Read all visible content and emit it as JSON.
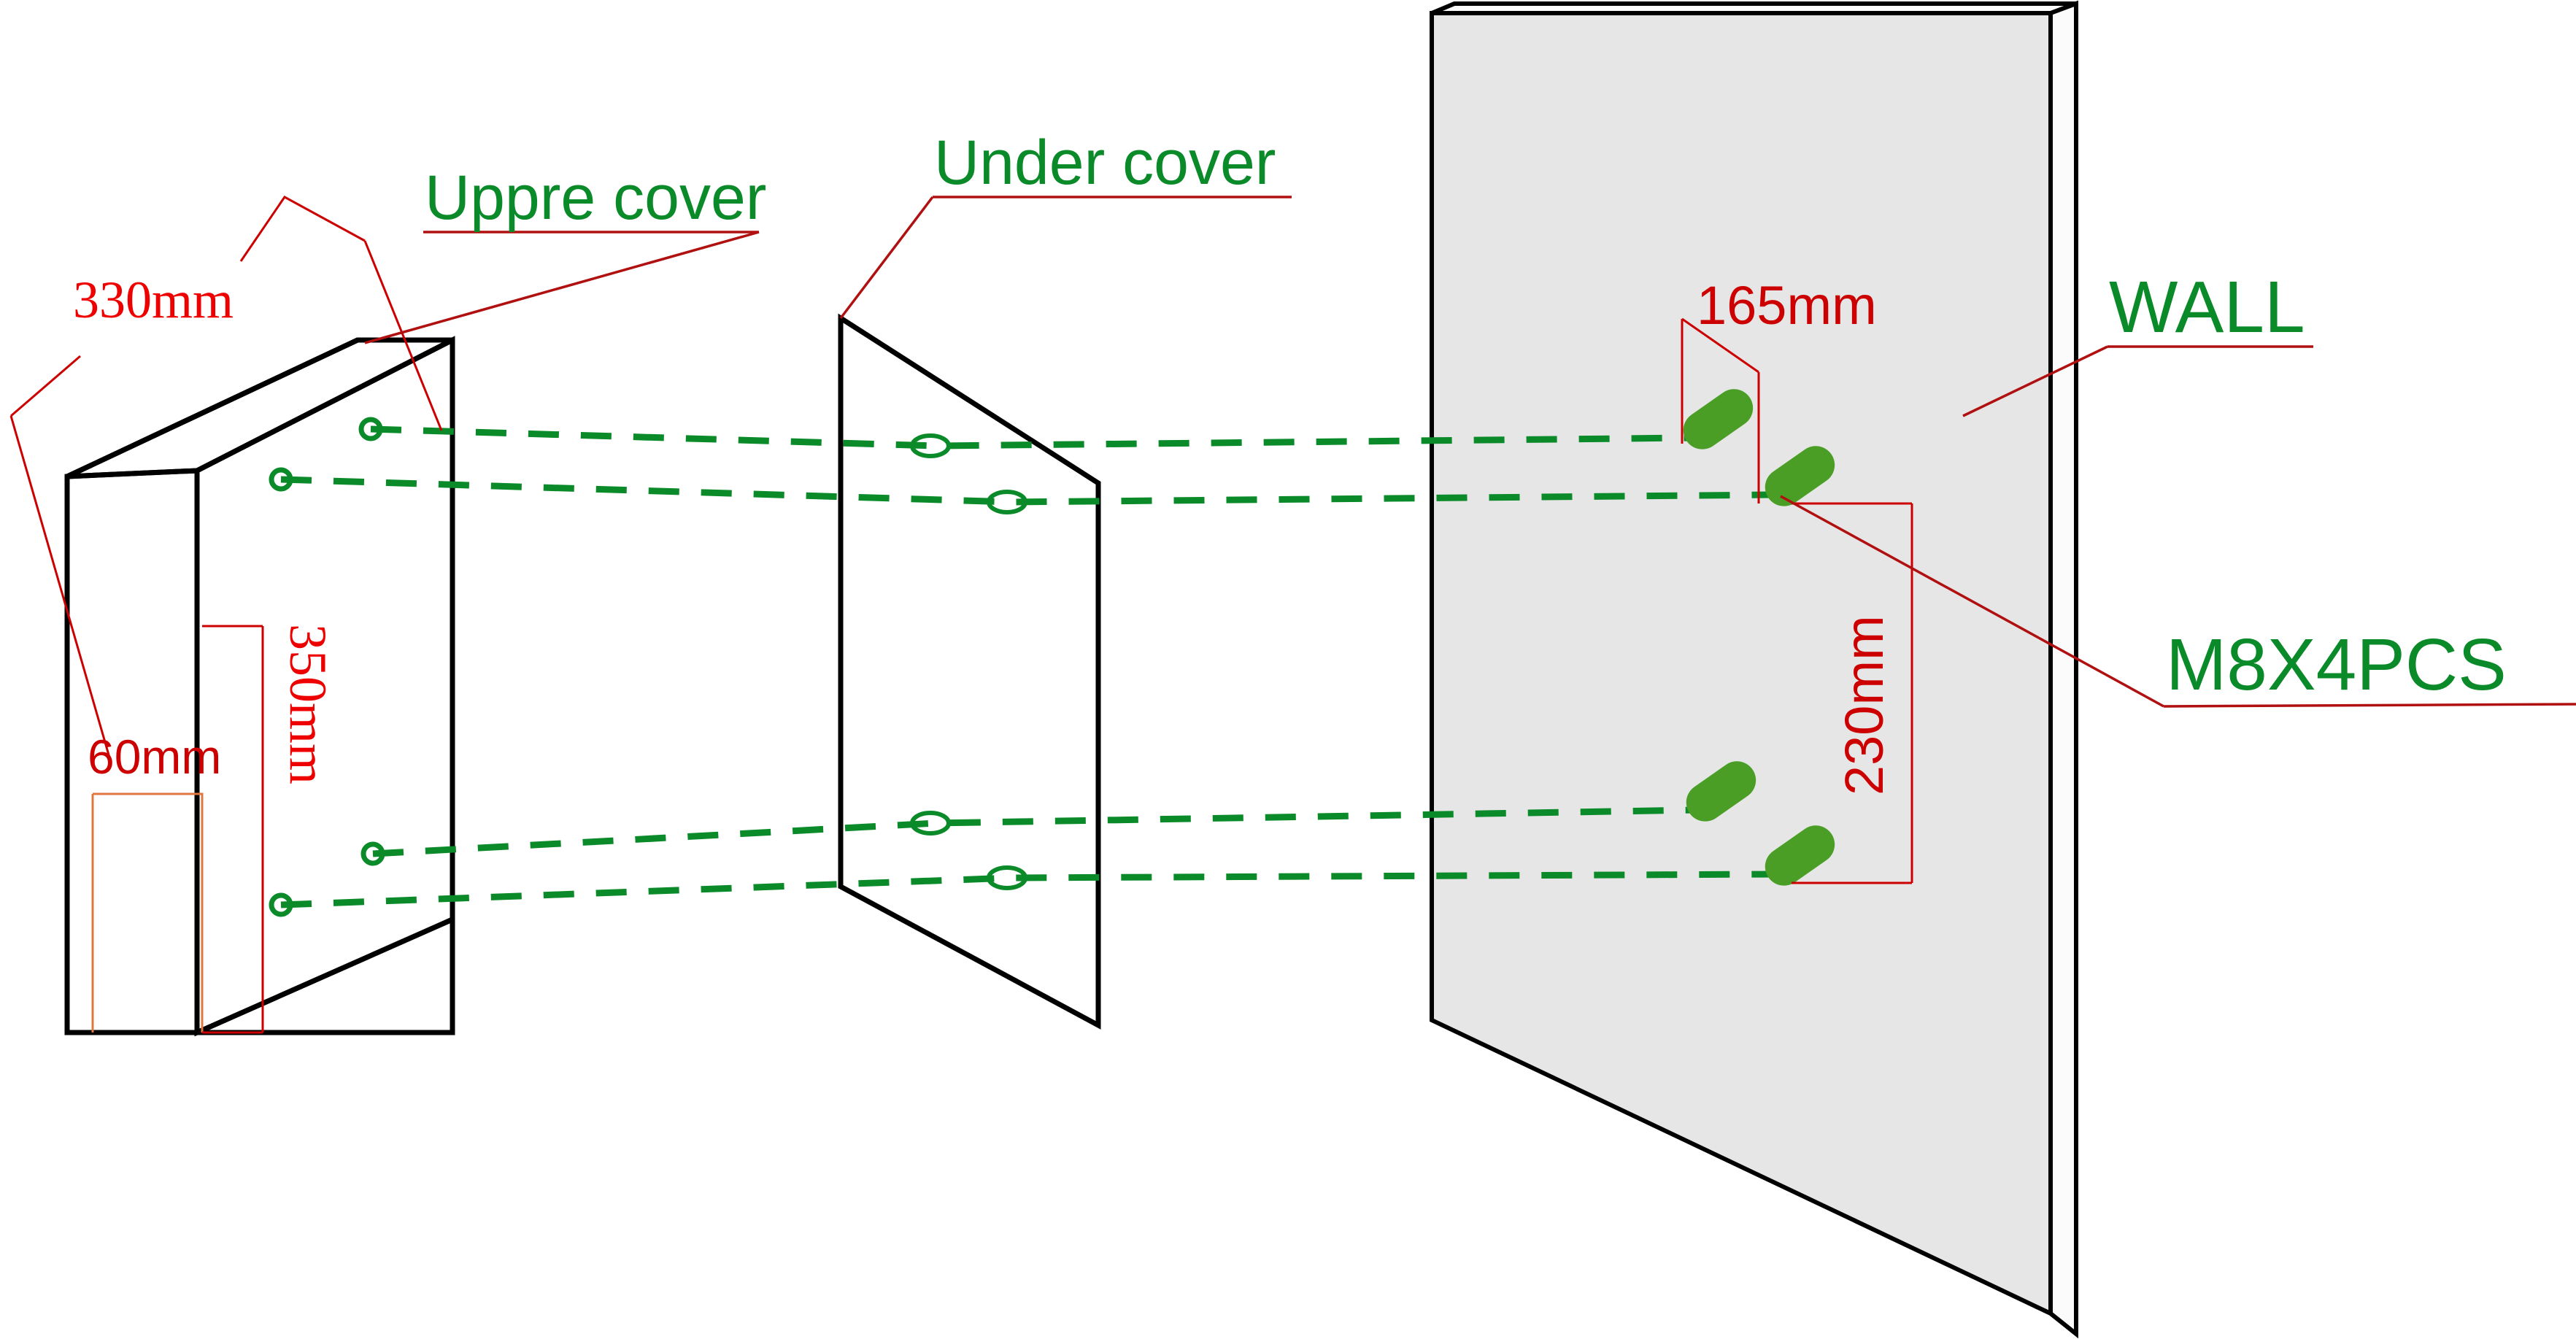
{
  "diagram": {
    "title": "Wall mount installation diagram",
    "background_color": "#ffffff",
    "colors": {
      "annotation_green": "#0a8a28",
      "dimension_red": "#cc0000",
      "dimension_red_bright": "#ee0000",
      "outline_black": "#000000",
      "wall_fill": "#e6e6e6",
      "bolt_green": "#4a9e26"
    }
  },
  "labels": {
    "upper_cover": "Uppre cover",
    "under_cover": "Under cover",
    "wall": "WALL",
    "bolt_spec": "M8X4PCS"
  },
  "dimensions": {
    "width_330": "330mm",
    "depth_60": "60mm",
    "height_350": "350mm",
    "bolt_spacing_horizontal_165": "165mm",
    "bolt_spacing_vertical_230": "230mm"
  },
  "parts": [
    {
      "name": "upper-cover",
      "label": "Uppre cover",
      "holes": 4
    },
    {
      "name": "under-cover",
      "label": "Under cover",
      "holes": 4
    },
    {
      "name": "wall",
      "label": "WALL",
      "bolts": 4
    }
  ],
  "hardware": {
    "type": "bolt",
    "spec": "M8X4PCS",
    "count": 4
  }
}
